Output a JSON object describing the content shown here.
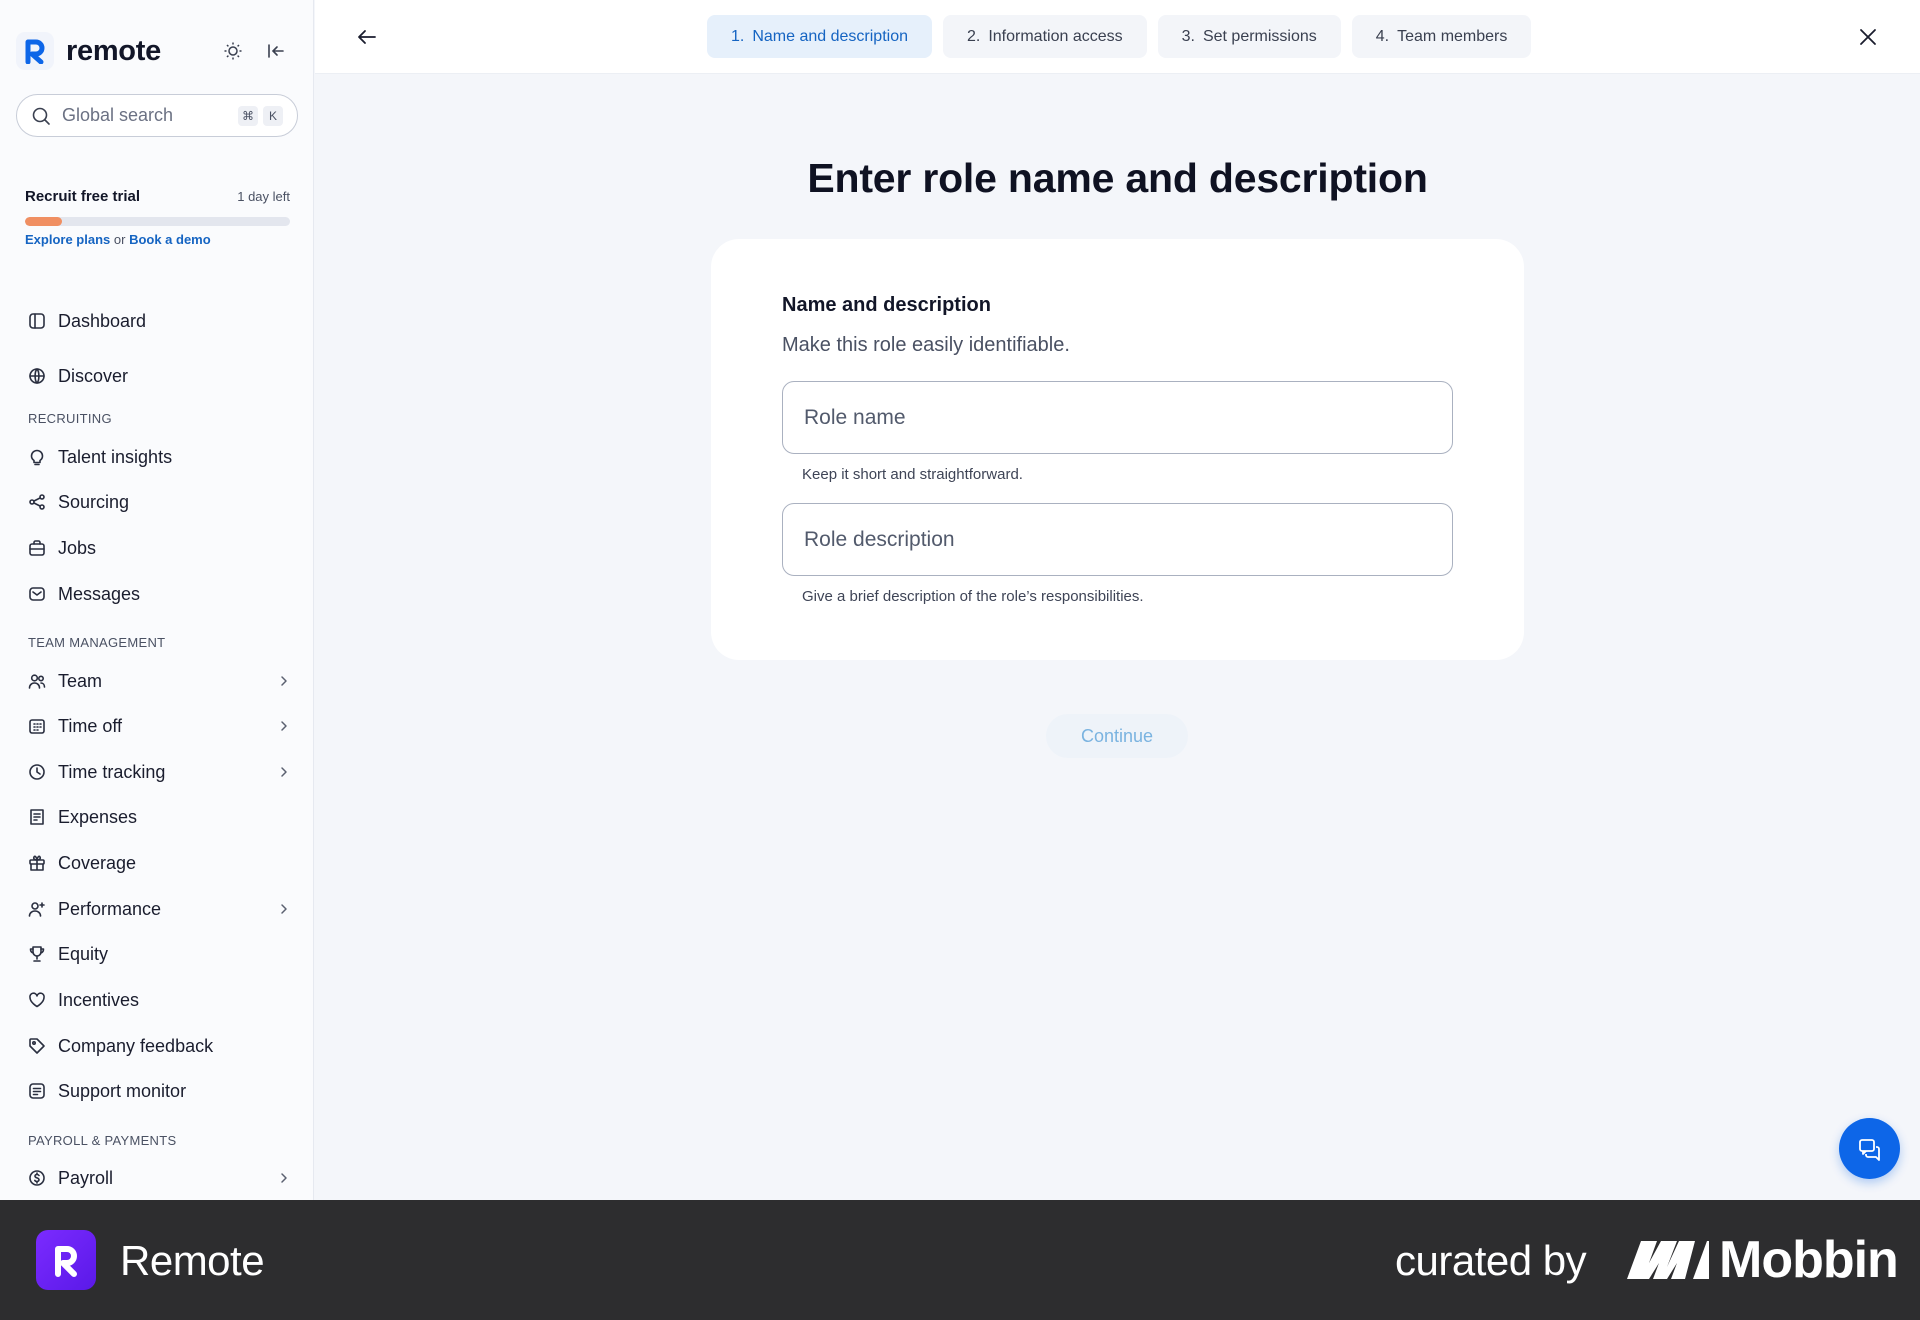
{
  "app": {
    "brand_name": "remote",
    "search_placeholder": "Global search",
    "search_shortcut": [
      "⌘",
      "K"
    ]
  },
  "trial": {
    "title": "Recruit free trial",
    "days_left": "1 day left",
    "progress": 0.14,
    "explore_label": "Explore plans",
    "or_text": "or",
    "demo_label": "Book a demo"
  },
  "sidebar": {
    "sections": {
      "recruiting": "RECRUITING",
      "team_management": "TEAM MANAGEMENT",
      "payroll": "PAYROLL & PAYMENTS"
    },
    "items": [
      {
        "label": "Dashboard",
        "icon": "dashboard-icon",
        "chevron": false
      },
      {
        "label": "Discover",
        "icon": "globe-icon",
        "chevron": false
      },
      {
        "label": "Talent insights",
        "icon": "lightbulb-icon",
        "chevron": false
      },
      {
        "label": "Sourcing",
        "icon": "share-nodes-icon",
        "chevron": false
      },
      {
        "label": "Jobs",
        "icon": "briefcase-icon",
        "chevron": false
      },
      {
        "label": "Messages",
        "icon": "message-icon",
        "chevron": false
      },
      {
        "label": "Team",
        "icon": "users-icon",
        "chevron": true
      },
      {
        "label": "Time off",
        "icon": "calendar-icon",
        "chevron": true
      },
      {
        "label": "Time tracking",
        "icon": "clock-icon",
        "chevron": true
      },
      {
        "label": "Expenses",
        "icon": "receipt-icon",
        "chevron": false
      },
      {
        "label": "Coverage",
        "icon": "gift-icon",
        "chevron": false
      },
      {
        "label": "Performance",
        "icon": "user-plus-icon",
        "chevron": true
      },
      {
        "label": "Equity",
        "icon": "trophy-icon",
        "chevron": false
      },
      {
        "label": "Incentives",
        "icon": "heart-icon",
        "chevron": false
      },
      {
        "label": "Company feedback",
        "icon": "tag-icon",
        "chevron": false
      },
      {
        "label": "Support monitor",
        "icon": "support-icon",
        "chevron": false
      },
      {
        "label": "Payroll",
        "icon": "dollar-icon",
        "chevron": true
      }
    ]
  },
  "steps": [
    {
      "num": "1.",
      "label": "Name and description",
      "active": true
    },
    {
      "num": "2.",
      "label": "Information access",
      "active": false
    },
    {
      "num": "3.",
      "label": "Set permissions",
      "active": false
    },
    {
      "num": "4.",
      "label": "Team members",
      "active": false
    }
  ],
  "main": {
    "title": "Enter role name and description",
    "card_title": "Name and description",
    "card_subtitle": "Make this role easily identifiable.",
    "role_name": {
      "placeholder": "Role name",
      "value": "",
      "hint": "Keep it short and straightforward."
    },
    "role_description": {
      "placeholder": "Role description",
      "value": "",
      "hint": "Give a brief description of the role’s responsibilities."
    },
    "continue_label": "Continue"
  },
  "footer": {
    "app_name": "Remote",
    "curated_by": "curated by",
    "mobbin": "Mobbin"
  },
  "colors": {
    "accent": "#1564c2",
    "chat_button": "#0d66e8",
    "trial_progress": "#f08f62",
    "footer_bg": "#2d2d2f"
  }
}
